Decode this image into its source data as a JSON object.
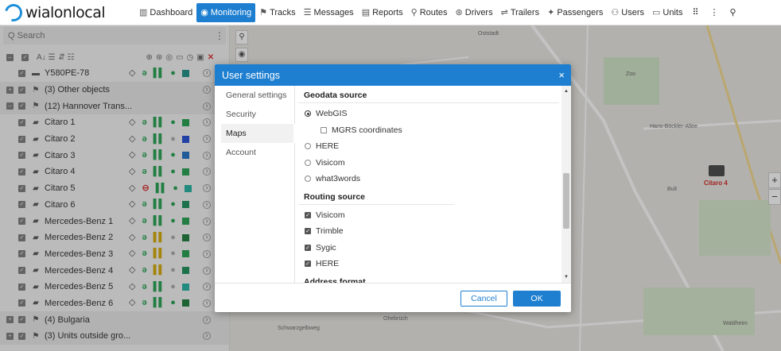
{
  "app": {
    "logo_text": "wialonlocal"
  },
  "nav": [
    {
      "label": "Dashboard",
      "icon": "chart-icon",
      "glyph": "▥",
      "active": false
    },
    {
      "label": "Monitoring",
      "icon": "globe-icon",
      "glyph": "◉",
      "active": true
    },
    {
      "label": "Tracks",
      "icon": "flag-icon",
      "glyph": "⚑",
      "active": false
    },
    {
      "label": "Messages",
      "icon": "messages-icon",
      "glyph": "☰",
      "active": false
    },
    {
      "label": "Reports",
      "icon": "reports-icon",
      "glyph": "▤",
      "active": false
    },
    {
      "label": "Routes",
      "icon": "routes-icon",
      "glyph": "⚲",
      "active": false
    },
    {
      "label": "Drivers",
      "icon": "steering-wheel-icon",
      "glyph": "⊛",
      "active": false
    },
    {
      "label": "Trailers",
      "icon": "trailer-icon",
      "glyph": "⇌",
      "active": false
    },
    {
      "label": "Passengers",
      "icon": "passengers-icon",
      "glyph": "✦",
      "active": false
    },
    {
      "label": "Users",
      "icon": "users-icon",
      "glyph": "⚇",
      "active": false
    },
    {
      "label": "Units",
      "icon": "units-icon",
      "glyph": "▭",
      "active": false
    }
  ],
  "nav_extra": {
    "apps_glyph": "⠿",
    "more_glyph": "⋮",
    "user_glyph": "⚲"
  },
  "search": {
    "placeholder": "Q Search",
    "more": "⋮"
  },
  "units_list": {
    "top_unit": {
      "name": "Y580PE-78",
      "color": "#1a8f86"
    },
    "groups": [
      {
        "name": "(3) Other objects",
        "expanded": false
      },
      {
        "name": "(12) Hannover Trans...",
        "expanded": true
      }
    ],
    "units": [
      {
        "name": "Citaro 1",
        "ign": "green",
        "bars": "green",
        "dot": "green",
        "color": "#21a04e"
      },
      {
        "name": "Citaro 2",
        "ign": "green",
        "bars": "green",
        "dot": "grey",
        "color": "#1f4bd6"
      },
      {
        "name": "Citaro 3",
        "ign": "green",
        "bars": "green",
        "dot": "green",
        "color": "#1e6fc5"
      },
      {
        "name": "Citaro 4",
        "ign": "green",
        "bars": "green",
        "dot": "green",
        "color": "#21a04e"
      },
      {
        "name": "Citaro 5",
        "ign": "red",
        "bars": "green",
        "dot": "green",
        "color": "#21b0a0"
      },
      {
        "name": "Citaro 6",
        "ign": "green",
        "bars": "green",
        "dot": "green",
        "color": "#1a8f5a"
      },
      {
        "name": "Mercedes-Benz 1",
        "ign": "green",
        "bars": "green",
        "dot": "green",
        "color": "#21a04e"
      },
      {
        "name": "Mercedes-Benz 2",
        "ign": "green",
        "bars": "yellow",
        "dot": "grey",
        "color": "#1a7a3a"
      },
      {
        "name": "Mercedes-Benz 3",
        "ign": "green",
        "bars": "yellow",
        "dot": "grey",
        "color": "#21a04e"
      },
      {
        "name": "Mercedes-Benz 4",
        "ign": "green",
        "bars": "yellow",
        "dot": "grey",
        "color": "#1a8f5a"
      },
      {
        "name": "Mercedes-Benz 5",
        "ign": "green",
        "bars": "green",
        "dot": "grey",
        "color": "#21b0a0"
      },
      {
        "name": "Mercedes-Benz 6",
        "ign": "green",
        "bars": "green",
        "dot": "green",
        "color": "#1a7a3a"
      }
    ],
    "bottom_groups": [
      {
        "name": "(4) Bulgaria"
      },
      {
        "name": "(3) Units outside gro..."
      }
    ]
  },
  "map": {
    "labels": [
      {
        "text": "Oststadt"
      },
      {
        "text": "Zoo"
      },
      {
        "text": "Hans-Böckler-Allee"
      },
      {
        "text": "Bult"
      },
      {
        "text": "Waldheim"
      },
      {
        "text": "Schwarzgelbweg"
      },
      {
        "text": "Ohebrüch"
      }
    ],
    "unit_label": "Citaro 4",
    "zoom_in": "+",
    "zoom_out": "−"
  },
  "dialog": {
    "title": "User settings",
    "close": "×",
    "tabs": [
      {
        "label": "General settings",
        "active": false
      },
      {
        "label": "Security",
        "active": false
      },
      {
        "label": "Maps",
        "active": true
      },
      {
        "label": "Account",
        "active": false
      }
    ],
    "geodata": {
      "title": "Geodata source",
      "options": [
        {
          "label": "WebGIS",
          "selected": true
        },
        {
          "label": "MGRS coordinates",
          "type": "checkbox",
          "checked": false
        },
        {
          "label": "HERE",
          "selected": false
        },
        {
          "label": "Visicom",
          "selected": false
        },
        {
          "label": "what3words",
          "selected": false
        }
      ]
    },
    "routing": {
      "title": "Routing source",
      "options": [
        {
          "label": "Visicom",
          "checked": true
        },
        {
          "label": "Trimble",
          "checked": true
        },
        {
          "label": "Sygic",
          "checked": true
        },
        {
          "label": "HERE",
          "checked": true
        }
      ]
    },
    "address_format_title": "Address format",
    "cancel": "Cancel",
    "ok": "OK"
  }
}
